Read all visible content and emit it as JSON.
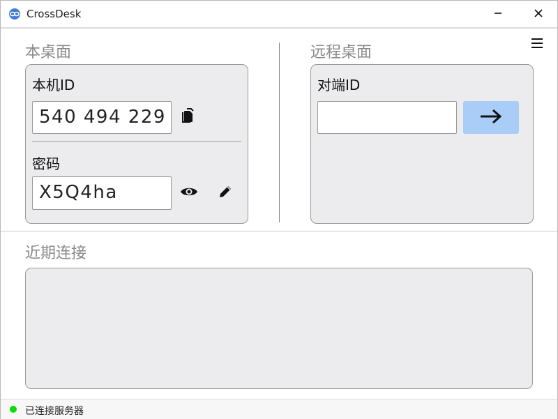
{
  "window": {
    "title": "CrossDesk",
    "min_icon": "minimize-icon",
    "close_icon": "close-icon"
  },
  "local": {
    "section_title": "本桌面",
    "id_label": "本机ID",
    "id_value": "540 494 229",
    "password_label": "密码",
    "password_value": "X5Q4ha",
    "copy_icon": "copy-icon",
    "show_icon": "eye-icon",
    "edit_icon": "pencil-icon"
  },
  "remote": {
    "section_title": "远程桌面",
    "peer_id_label": "对端ID",
    "peer_id_value": "",
    "connect_icon": "arrow-right-icon",
    "menu_icon": "hamburger-menu-icon"
  },
  "recent": {
    "section_title": "近期连接",
    "items": []
  },
  "status": {
    "text": "已连接服务器",
    "color": "#00e000"
  },
  "colors": {
    "panel_bg": "#ececee",
    "connect_button": "#a9cdf7",
    "section_title": "#8a8a8a"
  }
}
